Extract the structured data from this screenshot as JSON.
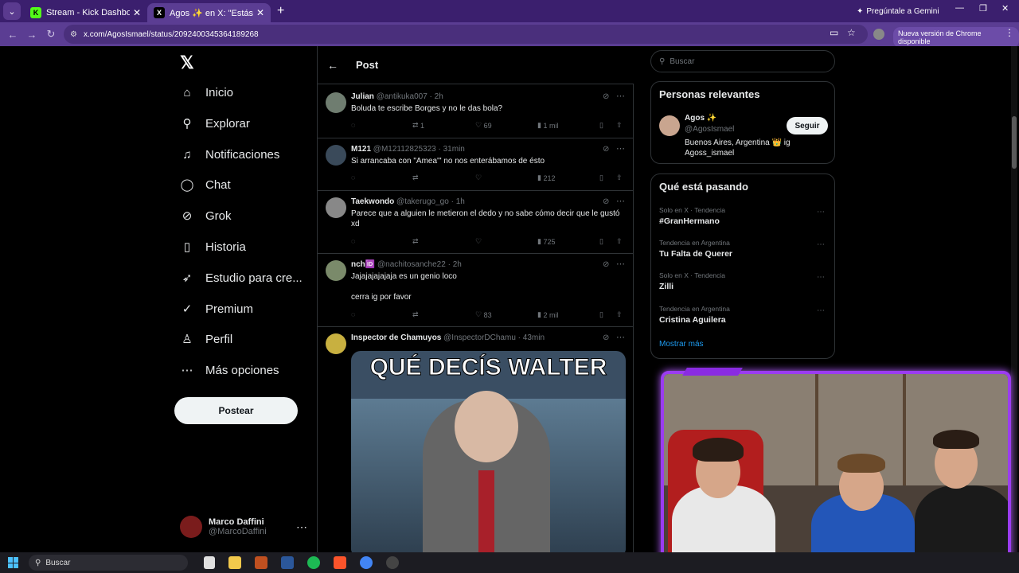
{
  "browser": {
    "tabs": [
      {
        "label": "Stream - Kick Dashboard",
        "favicon": "K",
        "color": "#53fc18"
      },
      {
        "label": "Agos ✨ en X: \"Estás soltera p",
        "favicon": "X",
        "color": "#000000"
      }
    ],
    "gemini_label": "Pregúntale a Gemini",
    "url": "x.com/AgosIsmael/status/2092400345364189268",
    "update_label": "Nueva versión de Chrome disponible"
  },
  "nav": {
    "items": [
      {
        "label": "Inicio",
        "icon": "home-icon",
        "glyph": "⌂"
      },
      {
        "label": "Explorar",
        "icon": "search-icon",
        "glyph": "⚲"
      },
      {
        "label": "Notificaciones",
        "icon": "bell-icon",
        "glyph": "♫"
      },
      {
        "label": "Chat",
        "icon": "chat-icon",
        "glyph": "◯"
      },
      {
        "label": "Grok",
        "icon": "grok-icon",
        "glyph": "⊘"
      },
      {
        "label": "Historia",
        "icon": "bookmark-icon",
        "glyph": "▯"
      },
      {
        "label": "Estudio para cre...",
        "icon": "rocket-icon",
        "glyph": "➶"
      },
      {
        "label": "Premium",
        "icon": "premium-icon",
        "glyph": "✓"
      },
      {
        "label": "Perfil",
        "icon": "profile-icon",
        "glyph": "♙"
      },
      {
        "label": "Más opciones",
        "icon": "more-icon",
        "glyph": "⋯"
      }
    ],
    "post_button": "Postear",
    "user": {
      "name": "Marco Daffini",
      "handle": "@MarcoDaffini"
    }
  },
  "header": {
    "title": "Post"
  },
  "replies": [
    {
      "name": "Julian",
      "handle": "@antikuka007",
      "time": "2h",
      "text": "Boluda te escribe Borges y no le das bola?",
      "retweets": "1",
      "likes": "69",
      "views": "1 mil",
      "avatar_color": "#6f7d70"
    },
    {
      "name": "M121",
      "handle": "@M12112825323",
      "time": "31min",
      "text": "Si arrancaba con \"Amea'\" no nos enterábamos de ésto",
      "retweets": "",
      "likes": "",
      "views": "212",
      "avatar_color": "#3a4a5a"
    },
    {
      "name": "Taekwondo",
      "handle": "@takerugo_go",
      "time": "1h",
      "text": "Parece que a alguien le metieron el dedo y no sabe cómo decir que le gustó xd",
      "retweets": "",
      "likes": "",
      "views": "725",
      "avatar_color": "#888888"
    },
    {
      "name": "nch🆔",
      "handle": "@nachitosanche22",
      "time": "2h",
      "text": "Jajajajajajaja es un genio loco\n\ncerra ig por favor",
      "retweets": "",
      "likes": "83",
      "views": "2 mil",
      "avatar_color": "#7a8a6a"
    },
    {
      "name": "Inspector de Chamuyos",
      "handle": "@InspectorDChamu",
      "time": "43min",
      "text": "",
      "meme_caption": "QUÉ DECÍS WALTER",
      "avatar_color": "#c8b040"
    }
  ],
  "right": {
    "search_placeholder": "Buscar",
    "relevant": {
      "title": "Personas relevantes",
      "name": "Agos ✨",
      "handle": "@AgosIsmael",
      "bio": "Buenos Aires, Argentina 👑 ig Agoss_ismael",
      "follow": "Seguir"
    },
    "trending": {
      "title": "Qué está pasando",
      "items": [
        {
          "context": "Solo en X · Tendencia",
          "topic": "#GranHermano"
        },
        {
          "context": "Tendencia en Argentina",
          "topic": "Tu Falta de Querer"
        },
        {
          "context": "Solo en X · Tendencia",
          "topic": "Zilli"
        },
        {
          "context": "Tendencia en Argentina",
          "topic": "Cristina Aguilera"
        }
      ],
      "show_more": "Mostrar más"
    }
  },
  "taskbar": {
    "search": "Buscar"
  }
}
